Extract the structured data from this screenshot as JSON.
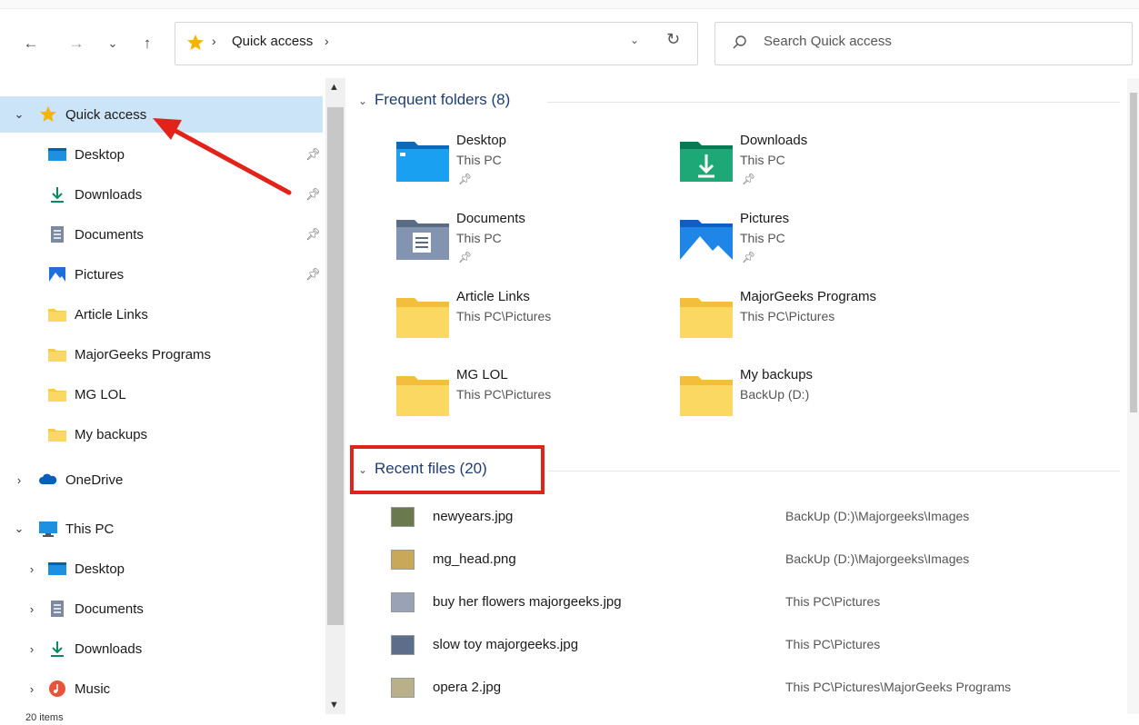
{
  "toolbar": {
    "back_icon": "back-arrow-icon",
    "forward_icon": "forward-arrow-icon",
    "recent_icon": "chevron-down-icon",
    "up_icon": "up-arrow-icon",
    "address": {
      "crumb": "Quick access",
      "sep": "›"
    },
    "search": {
      "placeholder": "Search Quick access"
    }
  },
  "sidebar": {
    "quick_access": "Quick access",
    "pinned": [
      {
        "label": "Desktop",
        "icon": "desktop-icon"
      },
      {
        "label": "Downloads",
        "icon": "downloads-icon"
      },
      {
        "label": "Documents",
        "icon": "documents-icon"
      },
      {
        "label": "Pictures",
        "icon": "pictures-icon"
      }
    ],
    "folders": [
      {
        "label": "Article Links"
      },
      {
        "label": "MajorGeeks Programs"
      },
      {
        "label": "MG LOL"
      },
      {
        "label": "My backups"
      }
    ],
    "onedrive": "OneDrive",
    "this_pc": "This PC",
    "pc_children": [
      {
        "label": "Desktop",
        "icon": "desktop-icon"
      },
      {
        "label": "Documents",
        "icon": "documents-icon"
      },
      {
        "label": "Downloads",
        "icon": "downloads-icon"
      },
      {
        "label": "Music",
        "icon": "music-icon"
      }
    ]
  },
  "main": {
    "frequent_header": "Frequent folders (8)",
    "recent_header": "Recent files (20)",
    "frequent": [
      {
        "name": "Desktop",
        "loc": "This PC",
        "pinned": true,
        "icon": "desktop-folder-icon"
      },
      {
        "name": "Downloads",
        "loc": "This PC",
        "pinned": true,
        "icon": "downloads-folder-icon"
      },
      {
        "name": "Documents",
        "loc": "This PC",
        "pinned": true,
        "icon": "documents-folder-icon"
      },
      {
        "name": "Pictures",
        "loc": "This PC",
        "pinned": true,
        "icon": "pictures-folder-icon"
      },
      {
        "name": "Article Links",
        "loc": "This PC\\Pictures",
        "pinned": false,
        "icon": "folder-icon"
      },
      {
        "name": "MajorGeeks Programs",
        "loc": "This PC\\Pictures",
        "pinned": false,
        "icon": "folder-icon"
      },
      {
        "name": "MG LOL",
        "loc": "This PC\\Pictures",
        "pinned": false,
        "icon": "folder-icon"
      },
      {
        "name": "My backups",
        "loc": "BackUp (D:)",
        "pinned": false,
        "icon": "folder-icon"
      }
    ],
    "recent": [
      {
        "name": "newyears.jpg",
        "path": "BackUp (D:)\\Majorgeeks\\Images"
      },
      {
        "name": "mg_head.png",
        "path": "BackUp (D:)\\Majorgeeks\\Images"
      },
      {
        "name": "buy her flowers majorgeeks.jpg",
        "path": "This PC\\Pictures"
      },
      {
        "name": "slow toy majorgeeks.jpg",
        "path": "This PC\\Pictures"
      },
      {
        "name": "opera 2.jpg",
        "path": "This PC\\Pictures\\MajorGeeks Programs"
      }
    ]
  },
  "status": {
    "count": "20 items"
  },
  "colors": {
    "selection": "#cce4f7",
    "header": "#1f3d73",
    "annotation": "#e2231a",
    "folder": "#f6c94a"
  }
}
